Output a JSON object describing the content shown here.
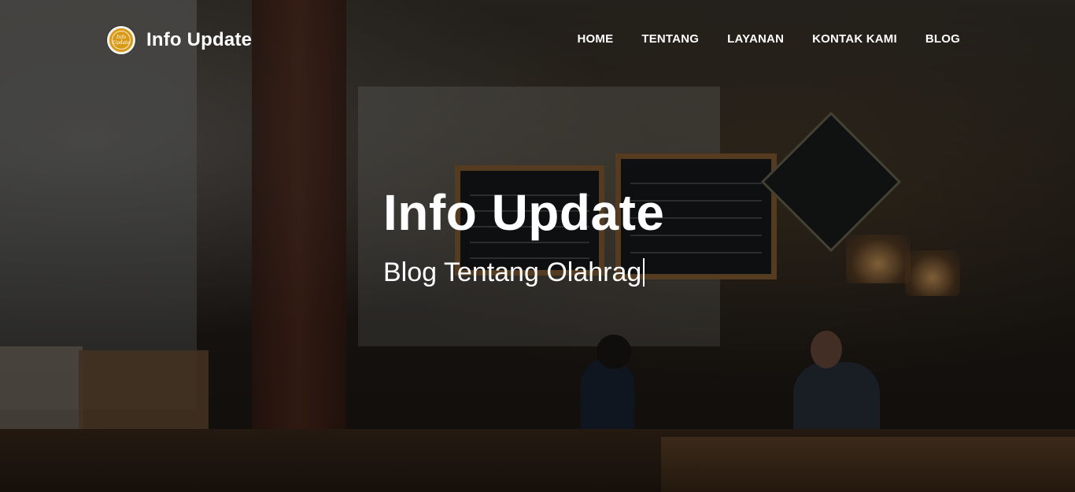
{
  "brand": {
    "name": "Info Update",
    "logo_icon": "info-update-logo-icon",
    "logo_text": "Info Update",
    "logo_color": "#d89a14"
  },
  "nav": {
    "items": [
      {
        "label": "HOME"
      },
      {
        "label": "TENTANG"
      },
      {
        "label": "LAYANAN"
      },
      {
        "label": "KONTAK KAMI"
      },
      {
        "label": "BLOG"
      }
    ]
  },
  "hero": {
    "title": "Info Update",
    "subtitle": "Blog Tentang Olahrag",
    "background": "cafe-interior-photo"
  }
}
